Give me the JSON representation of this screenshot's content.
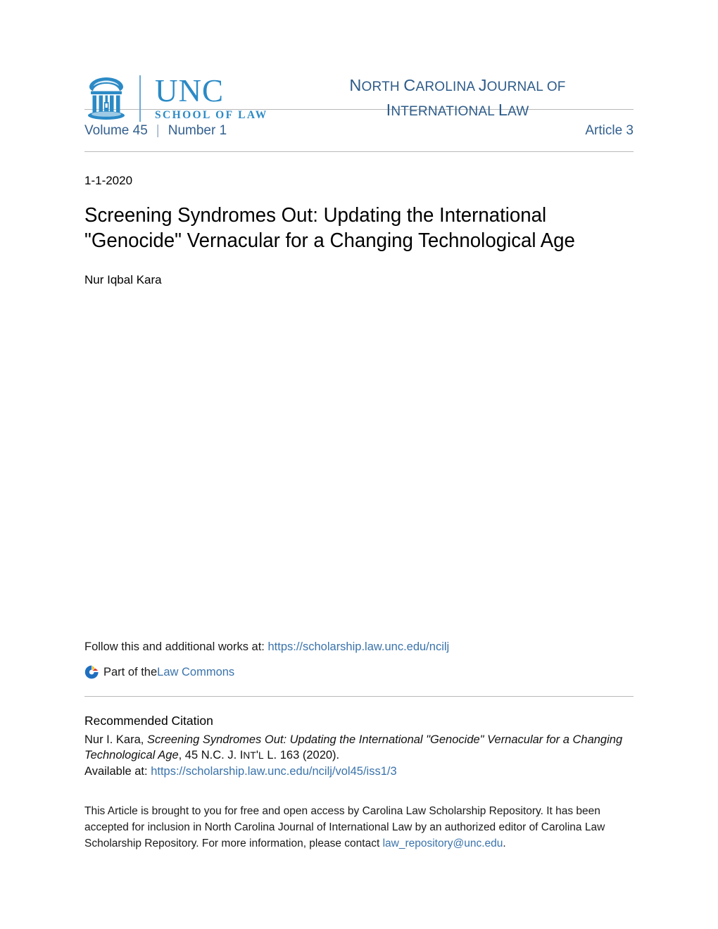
{
  "publisher": {
    "logo_word": "UNC",
    "logo_sub": "SCHOOL OF LAW",
    "logo_icon": "unc-old-well-icon",
    "logo_color": "#2b8ac6"
  },
  "journal": {
    "line1_cap": "N",
    "line1_rest_a": "ORTH ",
    "line1_cap2": "C",
    "line1_rest_b": "AROLINA ",
    "line1_cap3": "J",
    "line1_rest_c": "OURNAL OF",
    "line2_cap": "I",
    "line2_rest_a": "NTERNATIONAL ",
    "line2_cap2": "L",
    "line2_rest_b": "AW",
    "full_title": "North Carolina Journal of International Law",
    "color": "#2e5c8a"
  },
  "issue": {
    "volume": "Volume 45",
    "separator": "|",
    "number": "Number 1",
    "article": "Article 3",
    "color": "#33608f"
  },
  "article": {
    "date": "1-1-2020",
    "title": "Screening Syndromes Out: Updating the International \"Genocide\" Vernacular for a Changing Technological Age",
    "author": "Nur Iqbal Kara"
  },
  "follow": {
    "prefix": "Follow this and additional works at: ",
    "url": "https://scholarship.law.unc.edu/ncilj",
    "commons_icon": "digital-commons-network-icon",
    "part_of_prefix": "Part of the ",
    "commons_link": "Law Commons"
  },
  "citation": {
    "heading": "Recommended Citation",
    "author": "Nur I. Kara, ",
    "title_italic": "Screening Syndromes Out: Updating the International \"Genocide\" Vernacular for a Changing Technological Age",
    "source_a": ", 45 N.C. J. I",
    "source_smallcaps_a": "NT",
    "source_b": "'",
    "source_smallcaps_b": "L",
    "source_c": " L. 163 (2020).",
    "available_prefix": "Available at: ",
    "available_url": "https://scholarship.law.unc.edu/ncilj/vol45/iss1/3"
  },
  "footer": {
    "text_before_email": "This Article is brought to you for free and open access by Carolina Law Scholarship Repository. It has been accepted for inclusion in North Carolina Journal of International Law by an authorized editor of Carolina Law Scholarship Repository. For more information, please contact ",
    "email": "law_repository@unc.edu",
    "text_after_email": "."
  },
  "colors": {
    "link": "#3a73ab",
    "rule": "#b9b9b9",
    "unc_blue": "#2b8ac6",
    "journal_blue": "#2e5c8a"
  }
}
